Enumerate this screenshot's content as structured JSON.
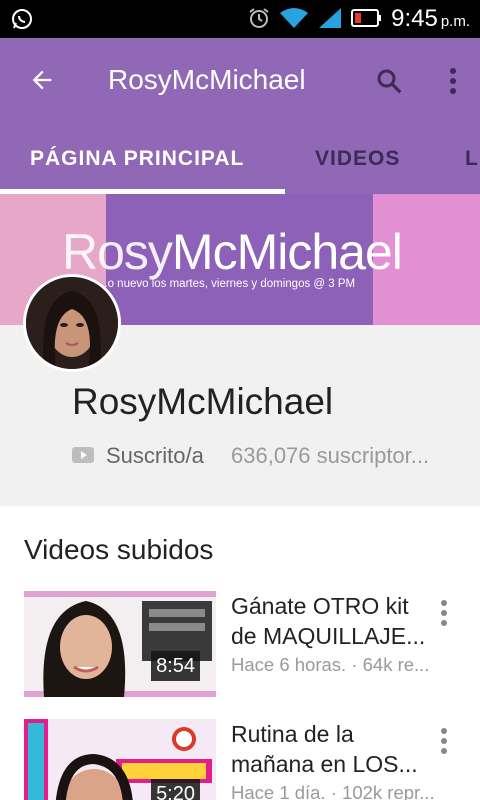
{
  "status_bar": {
    "time": "9:45",
    "ampm": "p.m.",
    "icons": [
      "whatsapp-icon",
      "alarm-icon",
      "wifi-icon",
      "signal-icon",
      "battery-icon"
    ]
  },
  "app_bar": {
    "title": "RosyMcMichael",
    "icons": [
      "back-arrow-icon",
      "search-icon",
      "more-vert-icon"
    ]
  },
  "tabs": [
    {
      "label": "PÁGINA PRINCIPAL",
      "active": true
    },
    {
      "label": "VIDEOS",
      "active": false
    },
    {
      "label": "L",
      "active": false
    }
  ],
  "banner": {
    "name_thin": "Rosy",
    "name_bold": "McMichael",
    "tagline": "...o nuevo los martes, viernes y domingos @ 3 PM"
  },
  "channel": {
    "name": "RosyMcMichael",
    "subscribed_label": "Suscrito/a",
    "subscriber_count": "636,076 suscriptor..."
  },
  "uploads": {
    "section_title": "Videos subidos",
    "videos": [
      {
        "title_line1": "Gánate OTRO kit",
        "title_line2": "de MAQUILLAJE...",
        "meta": "Hace 6 horas. · 64k re...",
        "duration": "8:54"
      },
      {
        "title_line1": "Rutina de la",
        "title_line2": "mañana en LOS...",
        "meta": "Hace 1 día. · 102k repr...",
        "duration": "5:20"
      }
    ]
  },
  "colors": {
    "accent": "#9068b6",
    "tab_inactive": "#3d2a55",
    "banner_pink": "#e7a7c9",
    "banner_purple": "#8c61b7"
  }
}
